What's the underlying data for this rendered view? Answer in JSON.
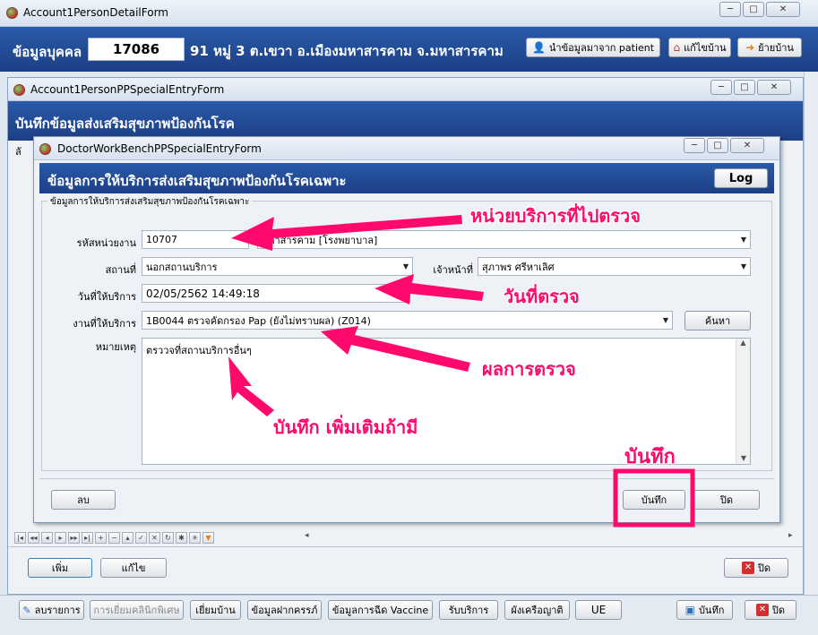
{
  "outer_window": {
    "title": "Account1PersonDetailForm"
  },
  "header": {
    "label": "ข้อมูลบุคคล",
    "person_id": "17086",
    "address": "91 หมู่ 3 ต.เขวา อ.เมืองมหาสารคาม จ.มหาสารคาม",
    "import_button": "นำข้อมูลมาจาก patient",
    "edit_house_button": "แก้ไขบ้าน",
    "move_house_button": "ย้ายบ้าน"
  },
  "mid_window": {
    "title": "Account1PersonPPSpecialEntryForm",
    "header": "บันทึกข้อมูลส่งเสริมสุขภาพป้องกันโรค",
    "left_stub": "ลั",
    "add_button": "เพิ่ม",
    "edit_button": "แก้ไข",
    "close_button": "ปิด"
  },
  "inner_window": {
    "title": "DoctorWorkBenchPPSpecialEntryForm",
    "header": "ข้อมูลการให้บริการส่งเสริมสุขภาพป้องกันโรคเฉพาะ",
    "log_button": "Log",
    "group_label": "ข้อมูลการให้บริการส่งเสริมสุขภาพป้องกันโรคเฉพาะ",
    "fields": {
      "unit_label": "รหัสหน่วยงาน",
      "unit_code": "10707",
      "unit_name": "มหาสารคาม [โรงพยาบาล]",
      "place_label": "สถานที่",
      "place_value": "นอกสถานบริการ",
      "staff_label": "เจ้าหน้าที่",
      "staff_value": "สุภาพร ศรีหาเลิศ",
      "date_label": "วันที่ให้บริการ",
      "date_value": "02/05/2562 14:49:18",
      "service_label": "งานที่ให้บริการ",
      "service_value": "1B0044 ตรวจคัดกรอง Pap (ยังไม่ทราบผล) (Z014)",
      "search_button": "ค้นหา",
      "note_label": "หมายเหตุ",
      "note_value": "ตรววจที่สถานบริการอื่นๆ"
    },
    "delete_button": "ลบ",
    "save_button": "บันทึก",
    "close_button": "ปิด"
  },
  "bottom_bar": {
    "buttons": [
      "ลบรายการ",
      "การเยี่ยมคลินิกพิเศษ",
      "เยี่ยมบ้าน",
      "ข้อมูลฝากครรภ์",
      "ข้อมูลการฉีด Vaccine",
      "รับบริการ",
      "ผังเครือญาติ",
      "UE"
    ],
    "save": "บันทึก",
    "close": "ปิด"
  },
  "annotations": {
    "unit": "หน่วยบริการที่ไปตรวจ",
    "date": "วันที่ตรวจ",
    "result": "ผลการตรวจ",
    "note": "บันทึก เพิ่มเติมถ้ามี",
    "save": "บันทึก"
  },
  "colors": {
    "accent_annotation": "#ff0a6c",
    "header_blue": "#1c3f85"
  },
  "icons": [
    "app-icon",
    "minimize-icon",
    "maximize-icon",
    "close-icon",
    "person-icon",
    "house-icon",
    "move-icon",
    "save-disk-icon",
    "red-close-icon"
  ]
}
